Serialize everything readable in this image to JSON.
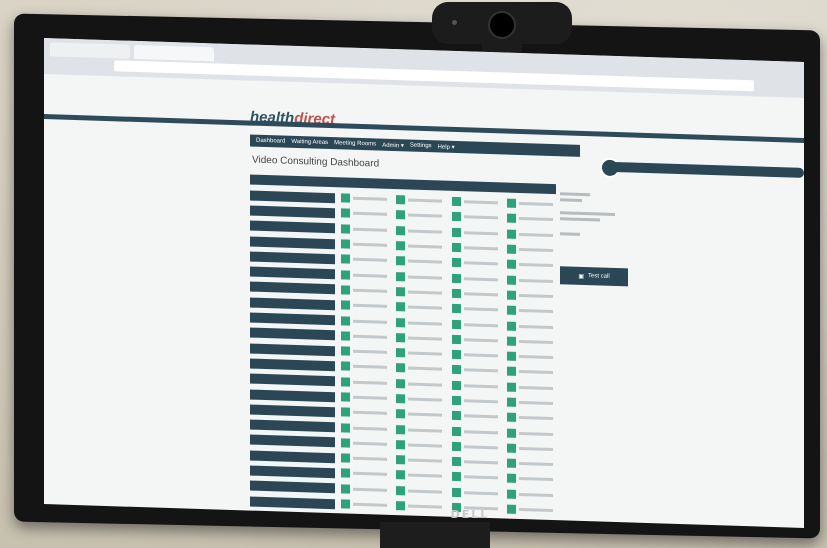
{
  "scene": {
    "monitor_brand": "DELL"
  },
  "app": {
    "logo_main": "health",
    "logo_accent": "direct",
    "nav": [
      "Dashboard",
      "Waiting Areas",
      "Meeting Rooms",
      "Admin ▾",
      "Settings",
      "Help ▾"
    ],
    "heading": "Video Consulting Dashboard",
    "call_button": "Test call",
    "rooms": [
      {
        "id": 1
      },
      {
        "id": 2
      },
      {
        "id": 3
      },
      {
        "id": 4
      },
      {
        "id": 5
      },
      {
        "id": 6
      },
      {
        "id": 7
      },
      {
        "id": 8
      },
      {
        "id": 9
      },
      {
        "id": 10
      },
      {
        "id": 11
      },
      {
        "id": 12
      },
      {
        "id": 13
      },
      {
        "id": 14
      },
      {
        "id": 15
      },
      {
        "id": 16
      },
      {
        "id": 17
      },
      {
        "id": 18
      },
      {
        "id": 19
      },
      {
        "id": 20
      },
      {
        "id": 21
      }
    ]
  },
  "colors": {
    "navy": "#2b4756",
    "green": "#2ea27a"
  }
}
